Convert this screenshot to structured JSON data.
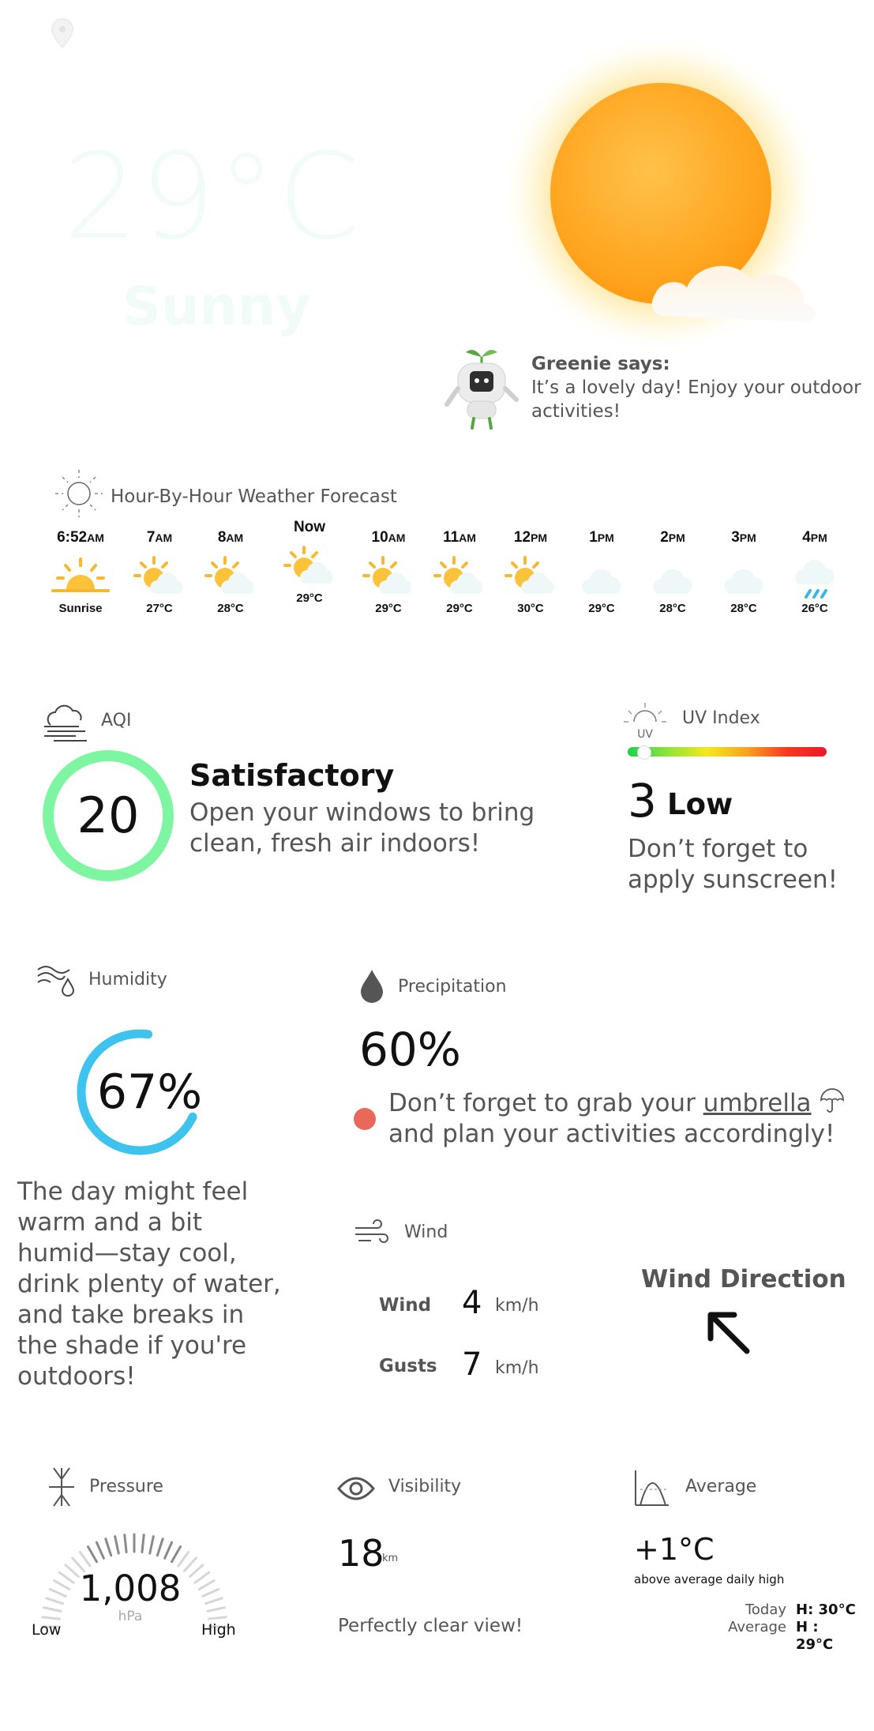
{
  "hero": {
    "temperature": "29°C",
    "condition": "Sunny"
  },
  "greenie": {
    "title": "Greenie says:",
    "message": "It’s a lovely day! Enjoy your outdoor activities!"
  },
  "hourly": {
    "title": "Hour-By-Hour Weather Forecast",
    "items": [
      {
        "time": "6:52",
        "ampm": "AM",
        "icon": "sunrise-icon",
        "value": "Sunrise"
      },
      {
        "time": "7",
        "ampm": "AM",
        "icon": "partly-sunny-icon",
        "value": "27°C"
      },
      {
        "time": "8",
        "ampm": "AM",
        "icon": "partly-sunny-icon",
        "value": "28°C"
      },
      {
        "time": "Now",
        "ampm": "",
        "icon": "partly-sunny-icon",
        "value": "29°C"
      },
      {
        "time": "10",
        "ampm": "AM",
        "icon": "partly-sunny-icon",
        "value": "29°C"
      },
      {
        "time": "11",
        "ampm": "AM",
        "icon": "partly-sunny-icon",
        "value": "29°C"
      },
      {
        "time": "12",
        "ampm": "PM",
        "icon": "partly-sunny-icon",
        "value": "30°C"
      },
      {
        "time": "1",
        "ampm": "PM",
        "icon": "cloud-icon",
        "value": "29°C"
      },
      {
        "time": "2",
        "ampm": "PM",
        "icon": "cloud-icon",
        "value": "28°C"
      },
      {
        "time": "3",
        "ampm": "PM",
        "icon": "cloud-icon",
        "value": "28°C"
      },
      {
        "time": "4",
        "ampm": "PM",
        "icon": "rain-icon",
        "value": "26°C"
      }
    ]
  },
  "aqi": {
    "label": "AQI",
    "value": "20",
    "status": "Satisfactory",
    "message": "Open your windows to bring clean, fresh air indoors!",
    "ring_color": "#7ef5a0"
  },
  "uv": {
    "label": "UV Index",
    "value": "3",
    "level": "Low",
    "message": "Don’t forget to apply sunscreen!"
  },
  "humidity": {
    "label": "Humidity",
    "value": "67%",
    "fraction": 0.67,
    "ring_color": "#3ec3ef",
    "message": "The day might feel warm and a bit humid—stay cool, drink plenty of water, and take breaks in the shade if you're outdoors!"
  },
  "precipitation": {
    "label": "Precipitation",
    "value": "60%",
    "message_before": "Don’t forget to grab your ",
    "umbrella_link": "umbrella",
    "message_after": "and plan your activities accordingly!",
    "dot_color": "#e8685a"
  },
  "wind": {
    "label": "Wind",
    "wind_label": "Wind",
    "wind_value": "4",
    "wind_unit": "km/h",
    "gusts_label": "Gusts",
    "gusts_value": "7",
    "gusts_unit": "km/h",
    "direction_title": "Wind Direction"
  },
  "pressure": {
    "label": "Pressure",
    "value": "1,008",
    "unit": "hPa",
    "low": "Low",
    "high": "High"
  },
  "visibility": {
    "label": "Visibility",
    "value": "18",
    "unit": "km",
    "message": "Perfectly clear view!"
  },
  "average": {
    "label": "Average",
    "value": "+1°C",
    "subtitle": "above average daily high",
    "today_label": "Today",
    "today_value": "H: 30°C",
    "avg_label": "Average",
    "avg_value": "H : 29°C"
  }
}
